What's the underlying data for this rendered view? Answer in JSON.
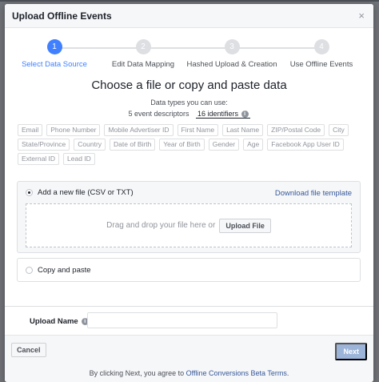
{
  "dialog": {
    "title": "Upload Offline Events",
    "close_glyph": "×"
  },
  "steps": [
    {
      "number": "1",
      "label": "Select Data Source",
      "active": true
    },
    {
      "number": "2",
      "label": "Edit Data Mapping",
      "active": false
    },
    {
      "number": "3",
      "label": "Hashed Upload & Creation",
      "active": false
    },
    {
      "number": "4",
      "label": "Use Offline Events",
      "active": false
    }
  ],
  "main": {
    "title": "Choose a file or copy and paste data",
    "types_label": "Data types you can use:",
    "descriptors": "5 event descriptors",
    "identifiers": "16 identifiers"
  },
  "tags": [
    "Email",
    "Phone Number",
    "Mobile Advertiser ID",
    "First Name",
    "Last Name",
    "ZIP/Postal Code",
    "City",
    "State/Province",
    "Country",
    "Date of Birth",
    "Year of Birth",
    "Gender",
    "Age",
    "Facebook App User ID",
    "External ID",
    "Lead ID"
  ],
  "upload": {
    "option_label": "Add a new file (CSV or TXT)",
    "download_link": "Download file template",
    "drop_text": "Drag and drop your file here or",
    "upload_button": "Upload File"
  },
  "copy": {
    "option_label": "Copy and paste"
  },
  "upload_name": {
    "label": "Upload Name",
    "value": "",
    "placeholder": ""
  },
  "footer": {
    "cancel": "Cancel",
    "next": "Next",
    "terms_prefix": "By clicking Next, you agree to",
    "terms_link": "Offline Conversions Beta Terms",
    "terms_suffix": "."
  },
  "icons": {
    "info_icon": "info-icon",
    "close_icon": "close-icon"
  },
  "colors": {
    "accent": "#4080ff",
    "link": "#365899",
    "next_disabled": "#9cb4d8"
  }
}
